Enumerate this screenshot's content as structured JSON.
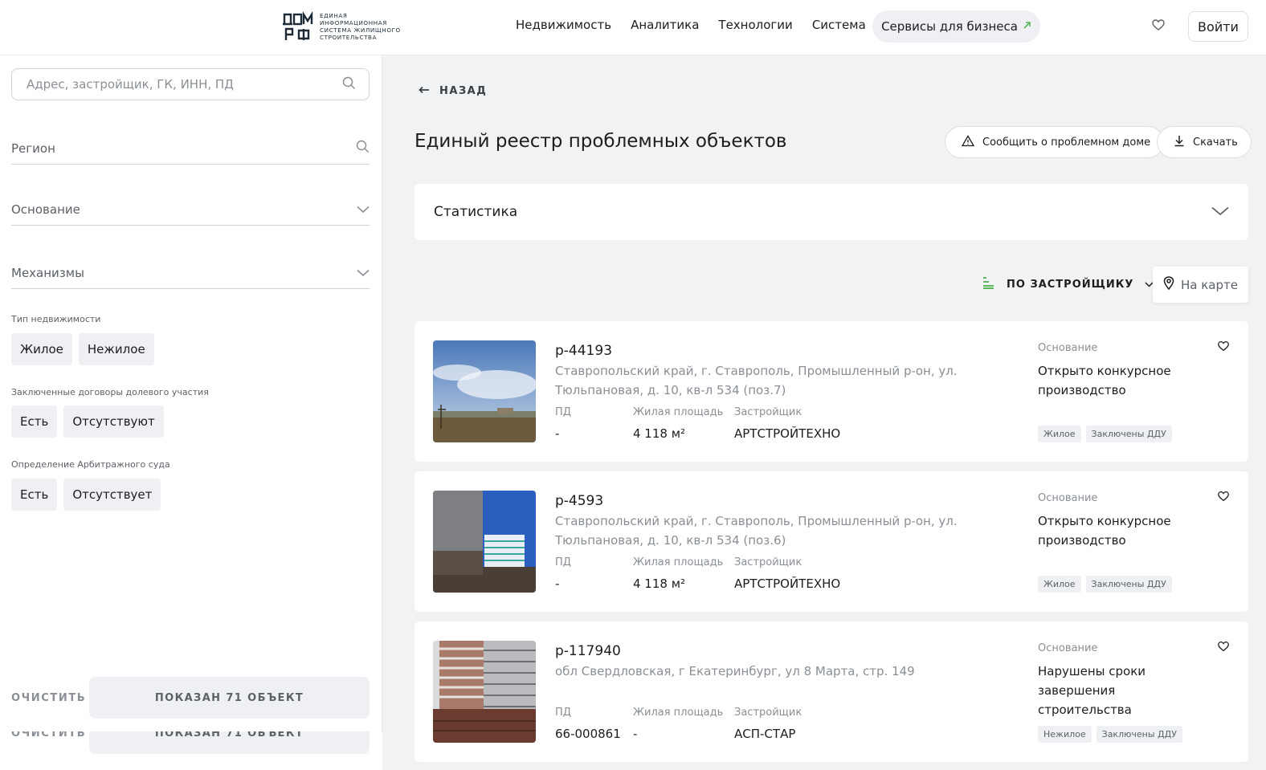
{
  "header": {
    "logo_mark": "ДОМ РФ",
    "logo_text": "ЕДИНАЯ\nИНФОРМАЦИОННАЯ\nСИСТЕМА ЖИЛИЩНОГО\nСТРОИТЕЛЬСТВА",
    "nav": [
      "Недвижимость",
      "Аналитика",
      "Технологии",
      "Система"
    ],
    "business_label": "Сервисы для бизнеса",
    "login_label": "Войти"
  },
  "sidebar": {
    "search_placeholder": "Адрес, застройщик, ГК, ИНН, ПД",
    "region_label": "Регион",
    "basis_label": "Основание",
    "mechanisms_label": "Механизмы",
    "property_type_label": "Тип недвижимости",
    "property_types": [
      "Жилое",
      "Нежилое"
    ],
    "ddu_label": "Заключенные договоры долевого участия",
    "ddu_options": [
      "Есть",
      "Отсутствуют"
    ],
    "court_label": "Определение Арбитражного суда",
    "court_options": [
      "Есть",
      "Отсутствует"
    ],
    "clear_label": "ОЧИСТИТЬ",
    "shown_label": "ПОКАЗАН 71 ОБЪЕКТ"
  },
  "main": {
    "back_label": "НАЗАД",
    "title": "Единый реестр проблемных объектов",
    "report_label": "Сообщить о проблемном доме",
    "download_label": "Скачать",
    "stats_label": "Статистика",
    "sort_label": "ПО ЗАСТРОЙЩИКУ",
    "map_label": "На карте",
    "field_labels": {
      "pd": "ПД",
      "area": "Жилая площадь",
      "developer": "Застройщик",
      "basis": "Основание"
    },
    "cards": [
      {
        "id": "р-44193",
        "address": "Ставропольский край, г. Ставрополь, Промышленный р-он, ул. Тюльпановая, д. 10, кв-л 534 (поз.7)",
        "pd": "-",
        "area": "4 118 м²",
        "developer": "АРТСТРОЙТЕХНО",
        "basis": "Открыто конкурсное производство",
        "tags": [
          "Жилое",
          "Заключены ДДУ"
        ]
      },
      {
        "id": "р-4593",
        "address": "Ставропольский край, г. Ставрополь, Промышленный р-он, ул. Тюльпановая, д. 10, кв-л 534 (поз.6)",
        "pd": "-",
        "area": "4 118 м²",
        "developer": "АРТСТРОЙТЕХНО",
        "basis": "Открыто конкурсное производство",
        "tags": [
          "Жилое",
          "Заключены ДДУ"
        ]
      },
      {
        "id": "р-117940",
        "address": "обл Свердловская, г Екатеринбург, ул 8 Марта, стр. 149",
        "pd": "66-000861",
        "area": "-",
        "developer": "АСП-СТАР",
        "basis": "Нарушены сроки завершения строительства",
        "tags": [
          "Нежилое",
          "Заключены ДДУ"
        ]
      }
    ]
  }
}
